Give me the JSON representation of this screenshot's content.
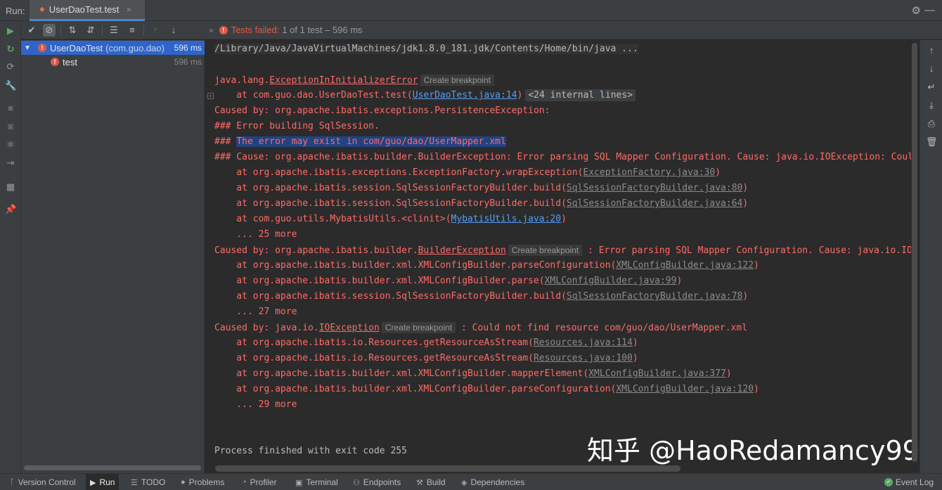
{
  "header": {
    "run_label": "Run:",
    "tab_name": "UserDaoTest.test",
    "tab_close": "×"
  },
  "toolbar": {
    "status_failed": "Tests failed:",
    "status_rest": "1 of 1 test – 596 ms"
  },
  "tree": {
    "root": {
      "name": "UserDaoTest",
      "pkg": "(com.guo.dao)",
      "time": "596 ms"
    },
    "child": {
      "name": "test",
      "time": "596 ms"
    }
  },
  "console": {
    "lines": [
      {
        "kind": "gray",
        "text": "/Library/Java/JavaVirtualMachines/jdk1.8.0_181.jdk/Contents/Home/bin/java ..."
      },
      {
        "kind": "blank",
        "text": ""
      },
      {
        "kind": "err",
        "prefix": "java.lang.",
        "ul": "ExceptionInInitializerError",
        "bp": "Create breakpoint",
        "suffix": ""
      },
      {
        "kind": "err",
        "prefix": "    at com.guo.dao.UserDaoTest.test(",
        "link": "UserDaoTest.java:14",
        "suffix": ")",
        "internal": "<24 internal lines>"
      },
      {
        "kind": "err",
        "text": "Caused by: org.apache.ibatis.exceptions.PersistenceException:"
      },
      {
        "kind": "err",
        "text": "### Error building SqlSession."
      },
      {
        "kind": "err",
        "prefix": "### ",
        "sel": "The error may exist in com/guo/dao/UserMapper.xml",
        "suffix": ""
      },
      {
        "kind": "err",
        "text": "### Cause: org.apache.ibatis.builder.BuilderException: Error parsing SQL Mapper Configuration. Cause: java.io.IOException: Coul"
      },
      {
        "kind": "err",
        "prefix": "    at org.apache.ibatis.exceptions.ExceptionFactory.wrapException(",
        "glink": "ExceptionFactory.java:30",
        "suffix": ")"
      },
      {
        "kind": "err",
        "prefix": "    at org.apache.ibatis.session.SqlSessionFactoryBuilder.build(",
        "glink": "SqlSessionFactoryBuilder.java:80",
        "suffix": ")"
      },
      {
        "kind": "err",
        "prefix": "    at org.apache.ibatis.session.SqlSessionFactoryBuilder.build(",
        "glink": "SqlSessionFactoryBuilder.java:64",
        "suffix": ")"
      },
      {
        "kind": "err",
        "prefix": "    at com.guo.utils.MybatisUtils.<clinit>(",
        "link": "MybatisUtils.java:20",
        "suffix": ")"
      },
      {
        "kind": "err",
        "text": "    ... 25 more"
      },
      {
        "kind": "err",
        "prefix": "Caused by: org.apache.ibatis.builder.",
        "ul": "BuilderException",
        "bp": "Create breakpoint",
        "suffix": " : Error parsing SQL Mapper Configuration. Cause: java.io.IO"
      },
      {
        "kind": "err",
        "prefix": "    at org.apache.ibatis.builder.xml.XMLConfigBuilder.parseConfiguration(",
        "glink": "XMLConfigBuilder.java:122",
        "suffix": ")"
      },
      {
        "kind": "err",
        "prefix": "    at org.apache.ibatis.builder.xml.XMLConfigBuilder.parse(",
        "glink": "XMLConfigBuilder.java:99",
        "suffix": ")"
      },
      {
        "kind": "err",
        "prefix": "    at org.apache.ibatis.session.SqlSessionFactoryBuilder.build(",
        "glink": "SqlSessionFactoryBuilder.java:78",
        "suffix": ")"
      },
      {
        "kind": "err",
        "text": "    ... 27 more"
      },
      {
        "kind": "err",
        "prefix": "Caused by: java.io.",
        "ul": "IOException",
        "bp": "Create breakpoint",
        "suffix": " : Could not find resource com/guo/dao/UserMapper.xml"
      },
      {
        "kind": "err",
        "prefix": "    at org.apache.ibatis.io.Resources.getResourceAsStream(",
        "glink": "Resources.java:114",
        "suffix": ")"
      },
      {
        "kind": "err",
        "prefix": "    at org.apache.ibatis.io.Resources.getResourceAsStream(",
        "glink": "Resources.java:100",
        "suffix": ")"
      },
      {
        "kind": "err",
        "prefix": "    at org.apache.ibatis.builder.xml.XMLConfigBuilder.mapperElement(",
        "glink": "XMLConfigBuilder.java:377",
        "suffix": ")"
      },
      {
        "kind": "err",
        "prefix": "    at org.apache.ibatis.builder.xml.XMLConfigBuilder.parseConfiguration(",
        "glink": "XMLConfigBuilder.java:120",
        "suffix": ")"
      },
      {
        "kind": "err",
        "text": "    ... 29 more"
      },
      {
        "kind": "blank",
        "text": ""
      },
      {
        "kind": "blank",
        "text": ""
      },
      {
        "kind": "gray",
        "text": "Process finished with exit code 255"
      }
    ]
  },
  "watermark": "知乎 @HaoRedamancy99",
  "bottombar": {
    "version_control": "Version Control",
    "run": "Run",
    "todo": "TODO",
    "problems": "Problems",
    "profiler": "Profiler",
    "terminal": "Terminal",
    "endpoints": "Endpoints",
    "build": "Build",
    "dependencies": "Dependencies",
    "event_log": "Event Log"
  },
  "colors": {
    "error": "#ff6b68",
    "link": "#589df6",
    "selection": "#214283",
    "accent": "#2f65ca"
  }
}
